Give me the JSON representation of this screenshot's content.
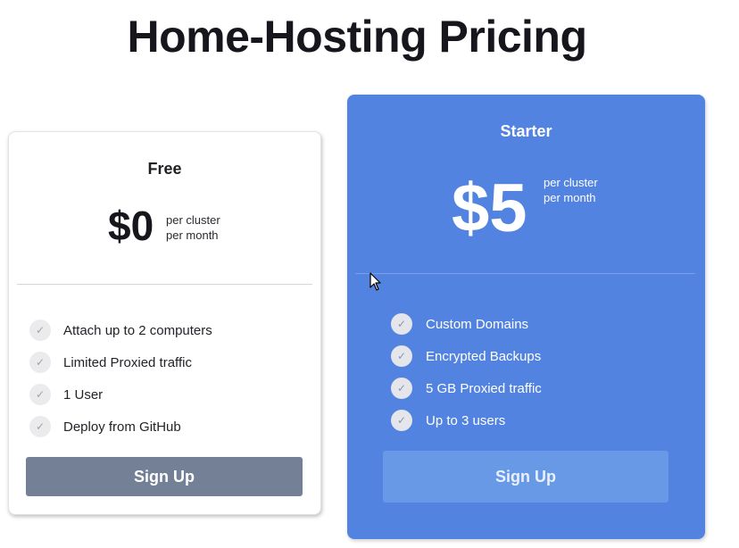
{
  "page": {
    "title": "Home-Hosting Pricing"
  },
  "plans": [
    {
      "name": "Free",
      "price": "$0",
      "price_note_line1": "per cluster",
      "price_note_line2": "per month",
      "features": [
        "Attach up to 2 computers",
        "Limited Proxied traffic",
        "1 User",
        "Deploy from GitHub"
      ],
      "button_label": "Sign Up"
    },
    {
      "name": "Starter",
      "price": "$5",
      "price_note_line1": "per cluster",
      "price_note_line2": "per month",
      "features": [
        "Custom Domains",
        "Encrypted Backups",
        "5 GB Proxied traffic",
        "Up to 3 users"
      ],
      "button_label": "Sign Up"
    }
  ],
  "icons": {
    "feature": "check-icon",
    "pointer": "mouse-cursor-icon"
  },
  "colors": {
    "starter_card": "#5283e0",
    "free_button": "#738095",
    "starter_button": "#6899e6"
  }
}
